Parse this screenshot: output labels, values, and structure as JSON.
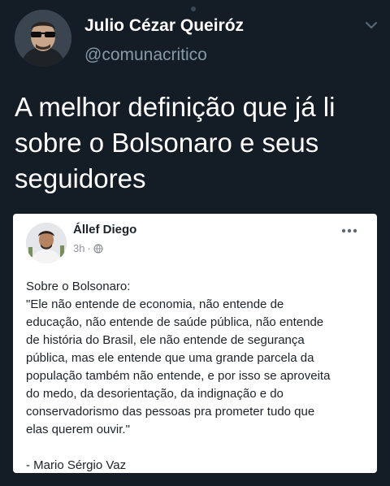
{
  "tweet": {
    "author": {
      "display_name": "Julio Cézar Queiróz",
      "username": "@comunacritico",
      "avatar_icon": "profile-photo-sunglasses"
    },
    "menu_icon": "chevron-down-icon",
    "text": "A melhor definição que já li sobre o Bolsonaro e seus seguidores"
  },
  "embedded_post": {
    "author_name": "Állef Diego",
    "time": "3h",
    "separator": "·",
    "privacy_icon": "globe-icon",
    "more_icon": "more-dots-icon",
    "body_lines": [
      "Sobre o Bolsonaro:",
      "\"Ele não entende de economia, não entende de",
      "educação, não entende de saúde pública, não entende",
      "de história do Brasil, ele não entende de segurança",
      "pública, mas ele entende que uma grande parcela da",
      "população também não entende, e por isso se aproveita",
      "do medo, da desorientação, da indignação e do",
      "conservadorismo das pessoas pra prometer tudo que",
      "elas querem ouvir.\""
    ],
    "signature": "- Mario Sérgio Vaz"
  },
  "colors": {
    "background": "#141d26",
    "username": "#8899a6",
    "card_bg": "#ffffff",
    "card_text": "#1d2129",
    "card_meta": "#90949c"
  }
}
